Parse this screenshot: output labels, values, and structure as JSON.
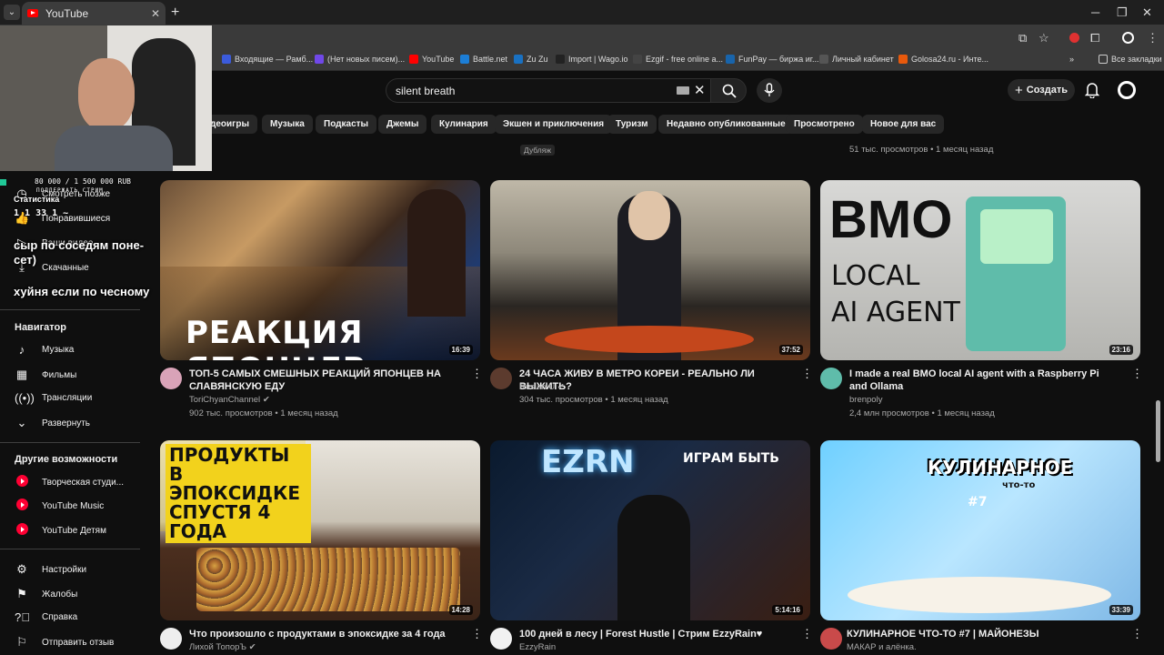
{
  "browser": {
    "tab_title": "YouTube",
    "bookmarks": [
      {
        "label": "Входящие — Рамб...",
        "color": "#3b5bdb"
      },
      {
        "label": "(Нет новых писем)...",
        "color": "#7048e8"
      },
      {
        "label": "YouTube",
        "color": "#ff0000"
      },
      {
        "label": "Battle.net",
        "color": "#1c7ed6"
      },
      {
        "label": "Zu Zu",
        "color": "#1971c2"
      },
      {
        "label": "Import | Wago.io",
        "color": "#222222"
      },
      {
        "label": "Ezgif - free online a...",
        "color": "#444444"
      },
      {
        "label": "FunPay — биржа иг...",
        "color": "#1864ab"
      },
      {
        "label": "Личный кабинет",
        "color": "#555555"
      },
      {
        "label": "Golosa24.ru - Инте...",
        "color": "#e8590c"
      }
    ],
    "all_bookmarks": "Все закладки"
  },
  "header": {
    "search_value": "silent breath",
    "create_label": "Создать"
  },
  "chips": [
    "деоигры",
    "Музыка",
    "Подкасты",
    "Джемы",
    "Кулинария",
    "Экшен и приключения",
    "Туризм",
    "Недавно опубликованные",
    "Просмотрено",
    "Новое для вас"
  ],
  "top_row": {
    "dub_label": "Дубляж",
    "right_meta": "51 тыс. просмотров • 1 месяц назад"
  },
  "sidebar": {
    "you_items": [
      "Смотреть позже",
      "Понравившиеся",
      "Ваши видео",
      "Скачанные"
    ],
    "navigator_heading": "Навигатор",
    "navigator": [
      {
        "label": "Музыка",
        "icon": "music-icon"
      },
      {
        "label": "Фильмы",
        "icon": "film-icon"
      },
      {
        "label": "Трансляции",
        "icon": "live-icon"
      },
      {
        "label": "Развернуть",
        "icon": "chevron-down-icon"
      }
    ],
    "more_heading": "Другие возможности",
    "more": [
      "Творческая студи...",
      "YouTube Music",
      "YouTube Детям"
    ],
    "footer": [
      {
        "label": "Настройки",
        "icon": "gear-icon"
      },
      {
        "label": "Жалобы",
        "icon": "flag-icon"
      },
      {
        "label": "Справка",
        "icon": "help-icon"
      },
      {
        "label": "Отправить отзыв",
        "icon": "feedback-icon"
      }
    ]
  },
  "overlay": {
    "goal": "80 000 / 1 500 000 RUB",
    "goal_sub": "ПОДДЕРЖАТЬ СТРИМ",
    "stats_label": "Статистика",
    "stats_line": "1   1   33   1   ~",
    "chat1": "сыр по соседям поне-",
    "chat2": "сет)",
    "chat3": "хуйня если по чесному"
  },
  "videos": [
    {
      "title": "ТОП-5 САМЫХ СМЕШНЫХ РЕАКЦИЙ ЯПОНЦЕВ НА СЛАВЯНСКУЮ ЕДУ",
      "channel": "ToriChyanChannel",
      "meta": "902 тыс. просмотров • 1 месяц назад",
      "duration": "16:39",
      "thumb_text": "РЕАКЦИЯ ЯПОНЦЕВ"
    },
    {
      "title": "24 ЧАСА ЖИВУ В МЕТРО КОРЕИ - РЕАЛЬНО ЛИ ВЫЖИТЬ?",
      "channel": "Ruslan U",
      "meta": "304 тыс. просмотров • 1 месяц назад",
      "duration": "37:52",
      "thumb_text": ""
    },
    {
      "title": "I made a real BMO local AI agent with a Raspberry Pi and Ollama",
      "channel": "brenpoly",
      "meta": "2,4 млн просмотров • 1 месяц назад",
      "duration": "23:16",
      "thumb_text": "BMO"
    },
    {
      "title": "Что произошло с продуктами в эпоксидке за 4 года",
      "channel": "Лихой ТопорЪ",
      "meta": "",
      "duration": "14:28",
      "thumb_text": "ПРОДУКТЫ В ЭПОКСИДКЕ СПУСТЯ 4 ГОДА"
    },
    {
      "title": "100 дней в лесу | Forest Hustle | Стрим EzzyRain♥",
      "channel": "EzzyRain",
      "meta": "",
      "duration": "5:14:16",
      "thumb_text": "EZRN"
    },
    {
      "title": "КУЛИНАРНОЕ ЧТО-ТО #7 | МАЙОНЕЗЫ",
      "channel": "МАКАР и алёнка.",
      "meta": "",
      "duration": "33:39",
      "thumb_text": "КУЛИНАРНОЕ"
    }
  ],
  "thumb_extra": {
    "bmo_line2": "LOCAL",
    "bmo_line3": "AI AGENT",
    "ezrn_sub": "ИГРАМ БЫТЬ",
    "kul_sub": "что-то",
    "kul_num": "#7"
  }
}
